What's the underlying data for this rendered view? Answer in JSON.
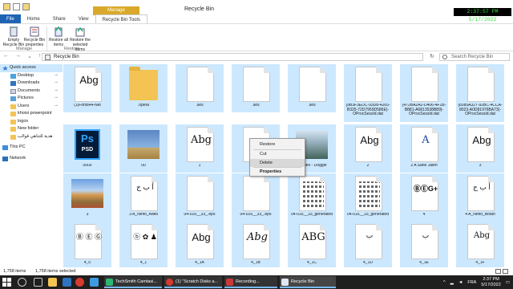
{
  "window": {
    "title": "Recycle Bin",
    "context_tab_group": "Manage",
    "controls": {
      "minimize": "—",
      "maximize": "☐",
      "close": "✕"
    }
  },
  "overlay_clock": "2:37:57 PM 5/17/2022",
  "ribbon": {
    "tabs": [
      "File",
      "Home",
      "Share",
      "View",
      "Recycle Bin Tools"
    ],
    "manage": {
      "empty": "Empty Recycle Bin",
      "properties": "Recycle Bin properties",
      "group": "Manage"
    },
    "restore": {
      "restore_all": "Restore all items",
      "restore_selected": "Restore the selected items",
      "group": "Restore"
    }
  },
  "address": {
    "back": "←",
    "forward": "→",
    "recent": "⌄",
    "up": "↑",
    "path": "Recycle Bin",
    "refresh": "↻",
    "search_placeholder": "Search Recycle Bin"
  },
  "nav": {
    "quick_access": "Quick access",
    "items": [
      {
        "label": "Desktop",
        "pinned": true
      },
      {
        "label": "Downloads",
        "pinned": true
      },
      {
        "label": "Documents",
        "pinned": true
      },
      {
        "label": "Pictures",
        "pinned": true
      },
      {
        "label": "Users",
        "pinned": true
      },
      {
        "label": "khoisi powerpoint",
        "pinned": false
      },
      {
        "label": "logos",
        "pinned": false
      },
      {
        "label": "New folder",
        "pinned": false
      },
      {
        "label": "هدية للتناهي قوالب",
        "pinned": false
      }
    ],
    "this_pc": "This PC",
    "network": "Network",
    "pin_glyph": "📌"
  },
  "files": {
    "row1": [
      {
        "label": "(1)Fonts44-Net",
        "preview": "Abg"
      },
      {
        "label": ".opera"
      },
      {
        "label": ".ses"
      },
      {
        "label": ".ses"
      },
      {
        "label": ".ses"
      },
      {
        "label": "{9B3F3EDC-93D8-4265-B325-72D7959D586E}-OProcSessId.dat"
      },
      {
        "label": "{472BA2A2-D406-4F1B-B881-A6813538B89}-OProcSessId.dat"
      },
      {
        "label": "{8385A327-92BC-4CCA-8023-A0D81976BA73}-OProcSessId.dat"
      }
    ],
    "row2": [
      {
        "label": "0000",
        "ps_main": "Ps",
        "ps_sub": "PSD"
      },
      {
        "label": "00"
      },
      {
        "label": "1",
        "preview": "Abg"
      },
      {
        "label": "1 A..."
      },
      {
        "label": "...Video - Doggie"
      },
      {
        "label": "2",
        "preview": "Abg"
      },
      {
        "label": "2 A Sane Jaleh",
        "preview": "A"
      },
      {
        "label": "3",
        "preview": "Abg"
      }
    ],
    "row3": [
      {
        "label": "3"
      },
      {
        "label": "3 A_Nefel_Adeti",
        "preview": "أ ب ج"
      },
      {
        "label": "04-016__33_.eps"
      },
      {
        "label": "04-016__33_.eps"
      },
      {
        "label": "04-016__33_generated"
      },
      {
        "label": "04-016__33_generated"
      },
      {
        "label": "4",
        "preview": "ⒷⒺG+"
      },
      {
        "label": "4 A_Nefel_Botan",
        "preview": "أ ب ج"
      }
    ],
    "row4": [
      {
        "label": "4_0",
        "preview": "Ⓑ Ⓔ Ⓖ"
      },
      {
        "label": "4_1",
        "preview": "ⓑ ✿ ♟"
      },
      {
        "label": "4_1A",
        "preview": "Abg"
      },
      {
        "label": "4_1B",
        "preview": "Abg"
      },
      {
        "label": "4_1C",
        "preview": "ABG"
      },
      {
        "label": "4_1D",
        "preview": "ب"
      },
      {
        "label": "4_1E",
        "preview": "ب"
      },
      {
        "label": "4_1F",
        "preview": "Abg"
      }
    ]
  },
  "context_menu": {
    "items": [
      "Restore",
      "Cut",
      "Delete",
      "Properties"
    ]
  },
  "status": {
    "count": "1,758 items",
    "selected": "1,758 items selected"
  },
  "taskbar": {
    "apps": [
      {
        "label": "TechSmith Camtasi..."
      },
      {
        "label": "(1) \"Scratch Disks a..."
      },
      {
        "label": "Recording..."
      },
      {
        "label": "Recycle Bin"
      }
    ],
    "tray": {
      "caret": "^",
      "lang": "FRA",
      "time": "2:37 PM",
      "date": "5/17/2022"
    }
  }
}
